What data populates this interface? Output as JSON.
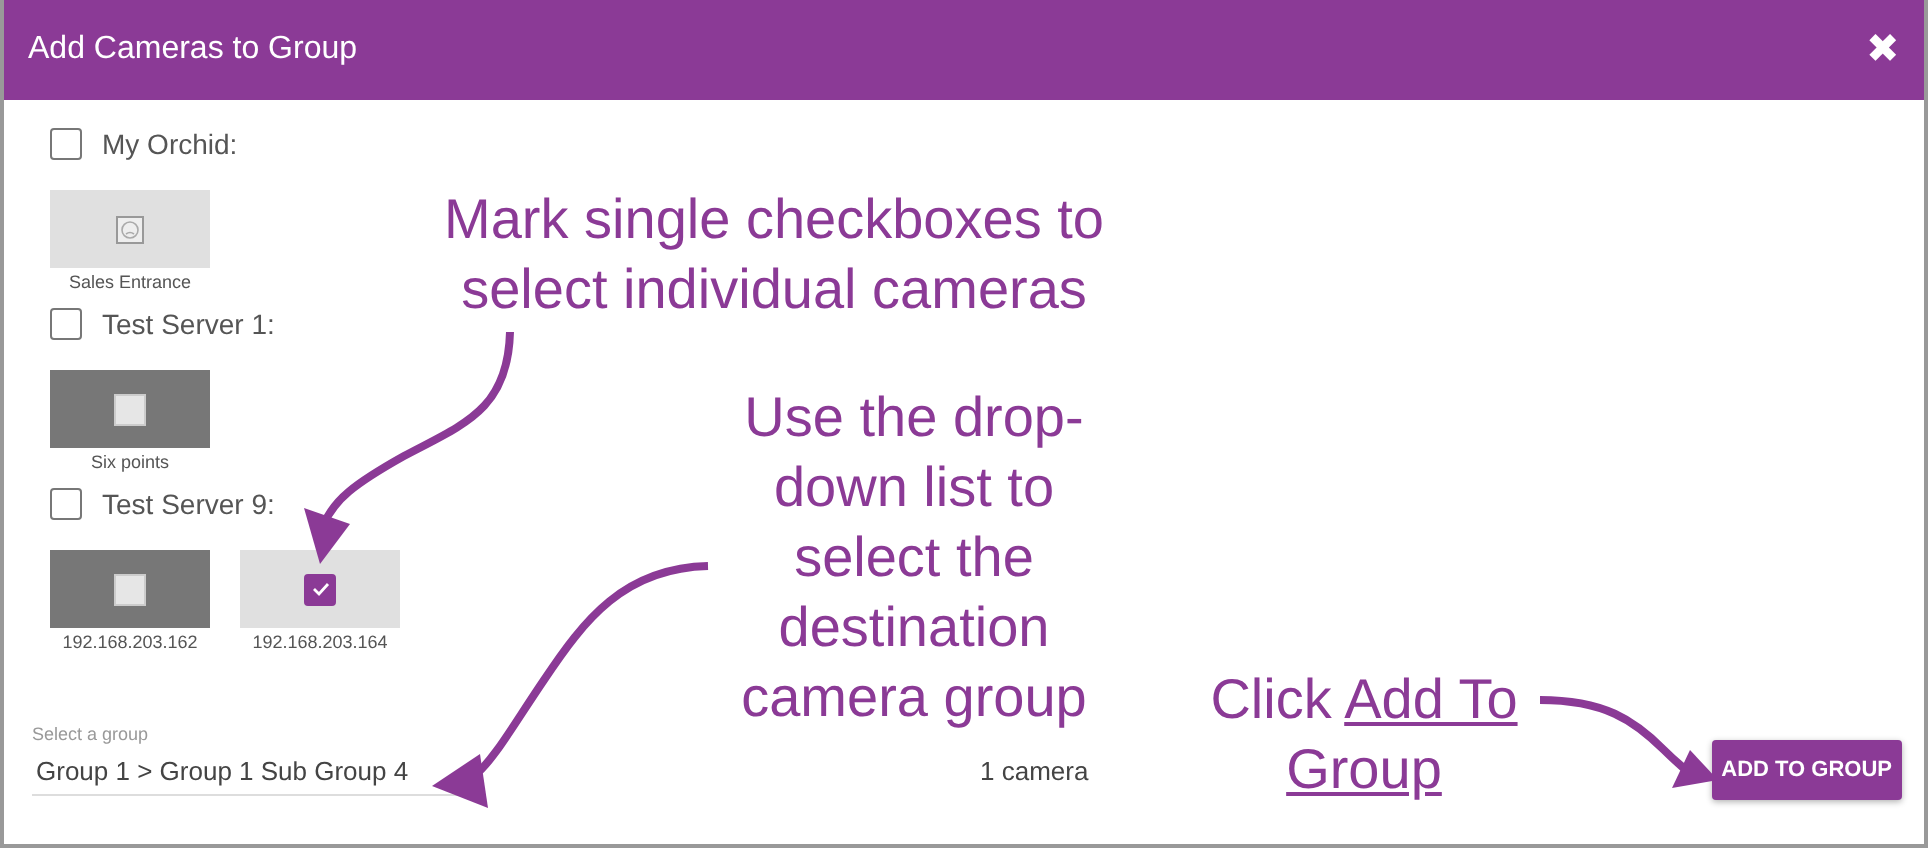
{
  "dialog": {
    "title": "Add Cameras to Group",
    "close": "✖"
  },
  "servers": [
    {
      "name": "My Orchid:",
      "checked": false,
      "cameras": [
        {
          "name": "Sales Entrance",
          "kind": "unavailable"
        }
      ]
    },
    {
      "name": "Test Server 1:",
      "checked": false,
      "cameras": [
        {
          "name": "Six points",
          "kind": "video",
          "checked": false
        }
      ]
    },
    {
      "name": "Test Server 9:",
      "checked": false,
      "cameras": [
        {
          "name": "192.168.203.162",
          "kind": "video",
          "checked": false
        },
        {
          "name": "192.168.203.164",
          "kind": "video",
          "checked": true
        }
      ]
    }
  ],
  "group_select": {
    "label": "Select a group",
    "value": "Group 1 > Group 1 Sub Group 4"
  },
  "camera_count": "1 camera",
  "add_button": "ADD TO GROUP",
  "annotations": [
    {
      "kind": "note",
      "text": "Mark single checkboxes to select individual cameras"
    },
    {
      "kind": "note",
      "text": "Use the drop-down list to select the destination camera group"
    },
    {
      "kind": "link_note",
      "text": "Click",
      "link": "Add To Group"
    }
  ]
}
